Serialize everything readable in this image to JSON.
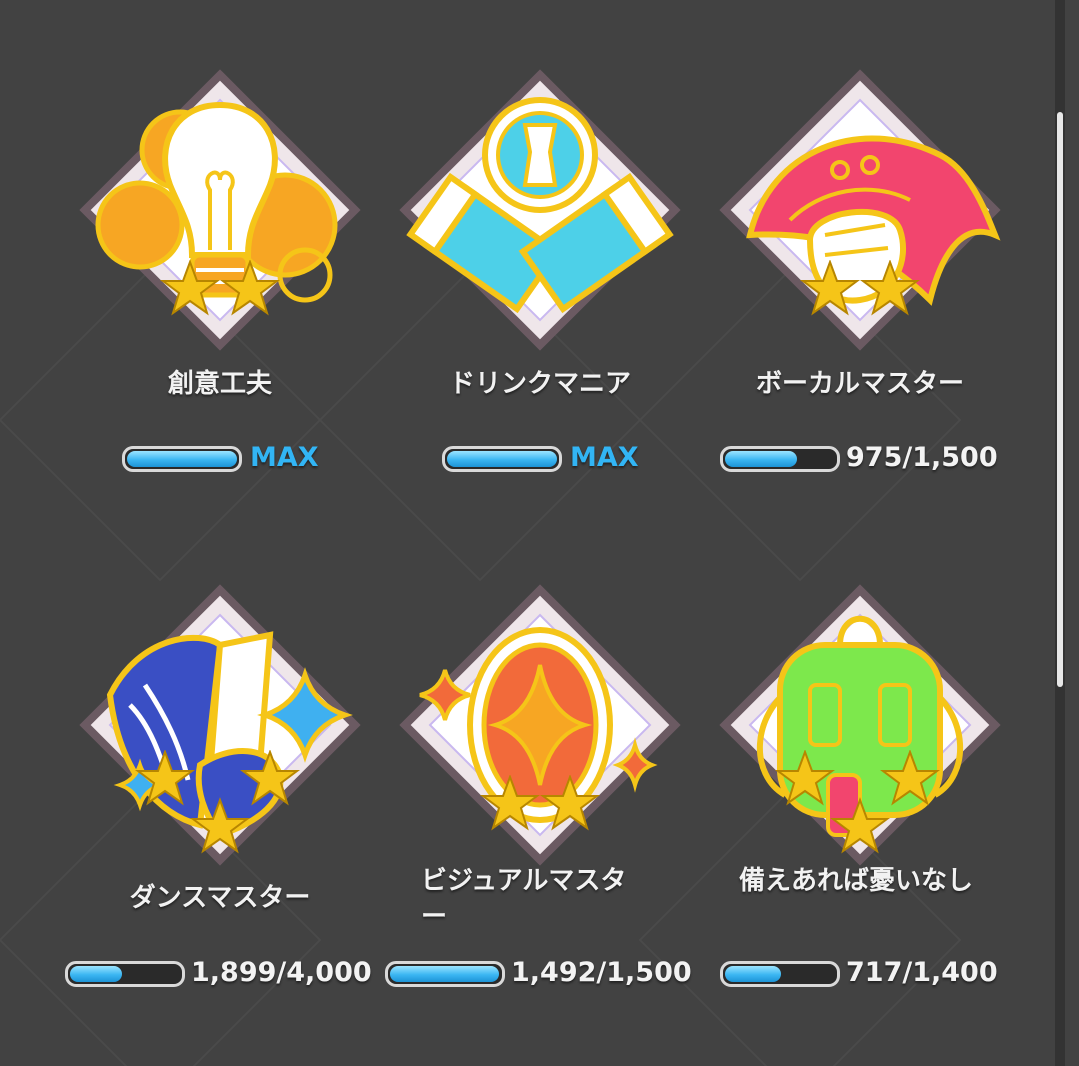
{
  "achievements": [
    {
      "title": "創意工夫",
      "progress_text": "MAX",
      "progress": 1.0,
      "stars": 2,
      "icon": "lightbulb-icon",
      "colors": {
        "main": "#f7a623",
        "accent": "#ffffff"
      }
    },
    {
      "title": "ドリンクマニア",
      "progress_text": "MAX",
      "progress": 1.0,
      "stars": 0,
      "icon": "drink-icon",
      "colors": {
        "main": "#4dd0e8",
        "accent": "#ffffff"
      }
    },
    {
      "title": "ボーカルマスター",
      "progress_text": "975/1,500",
      "progress": 0.65,
      "stars": 2,
      "icon": "microphone-fist-icon",
      "colors": {
        "main": "#f2456e",
        "accent": "#ffffff"
      }
    },
    {
      "title": "ダンスマスター",
      "progress_text": "1,899/4,000",
      "progress": 0.475,
      "stars": 3,
      "icon": "dance-shoes-icon",
      "colors": {
        "main": "#3a4fc4",
        "accent": "#3fb0f0"
      }
    },
    {
      "title": "ビジュアルマスター",
      "progress_text": "1,492/1,500",
      "progress": 0.995,
      "stars": 2,
      "icon": "mirror-icon",
      "colors": {
        "main": "#f26a3a",
        "accent": "#f7a623"
      }
    },
    {
      "title": "備えあれば憂いなし",
      "progress_text": "717/1,400",
      "progress": 0.51,
      "stars": 3,
      "icon": "backpack-icon",
      "colors": {
        "main": "#7de84c",
        "accent": "#f2456e"
      }
    }
  ],
  "theme": {
    "background": "#424242",
    "gold": "#f5c518",
    "bar_fill": "#3bb6f2",
    "max_color": "#32b5f5"
  }
}
